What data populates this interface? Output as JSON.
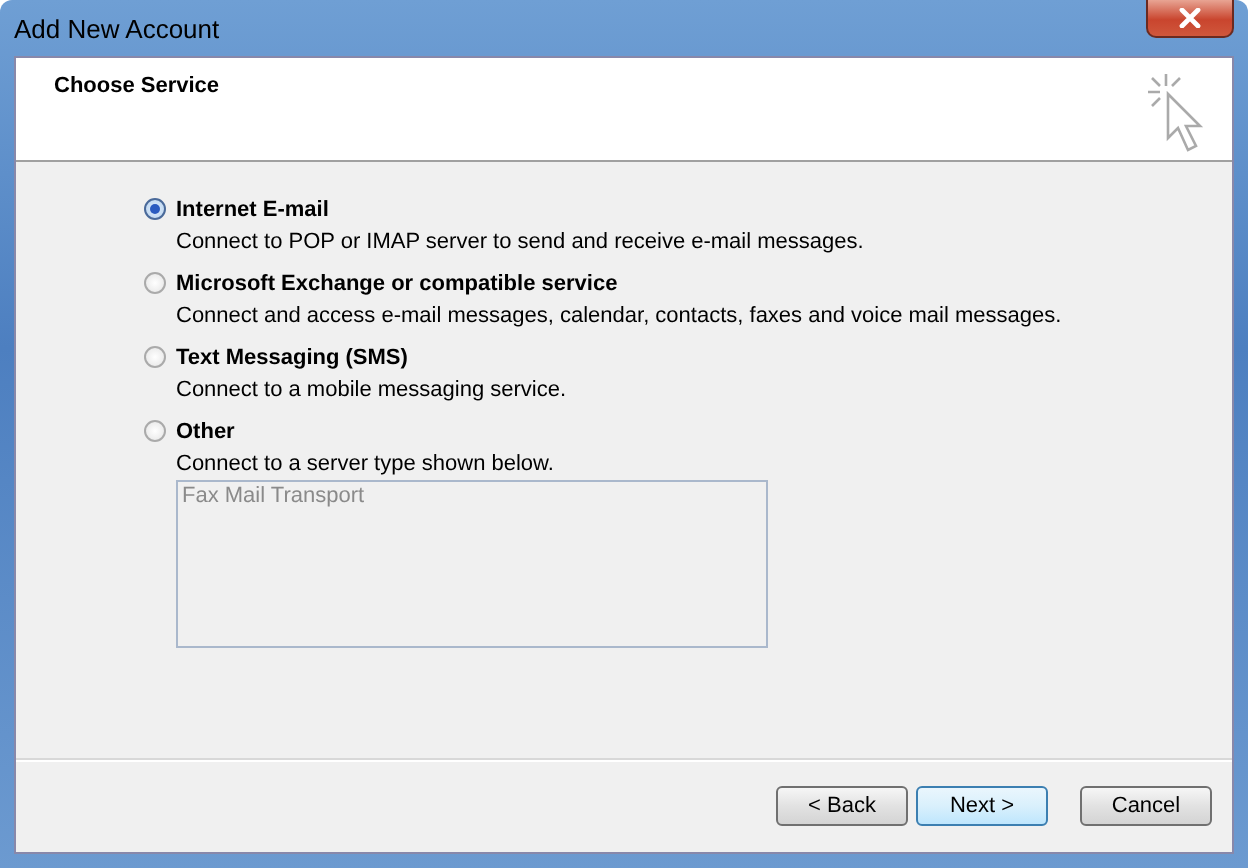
{
  "window": {
    "title": "Add New Account"
  },
  "header": {
    "title": "Choose Service"
  },
  "services": [
    {
      "label": "Internet E-mail",
      "description": "Connect to POP or IMAP server to send and receive e-mail messages.",
      "selected": true
    },
    {
      "label": "Microsoft Exchange or compatible service",
      "description": "Connect and access e-mail messages, calendar, contacts, faxes and voice mail messages.",
      "selected": false
    },
    {
      "label": "Text Messaging (SMS)",
      "description": "Connect to a mobile messaging service.",
      "selected": false
    },
    {
      "label": "Other",
      "description": "Connect to a server type shown below.",
      "selected": false
    }
  ],
  "server_types": {
    "disabled": true,
    "items": [
      "Fax Mail Transport"
    ]
  },
  "buttons": [
    {
      "label": "< Back",
      "default": false
    },
    {
      "label": "Next >",
      "default": true
    },
    {
      "label": "Cancel",
      "default": false
    }
  ]
}
